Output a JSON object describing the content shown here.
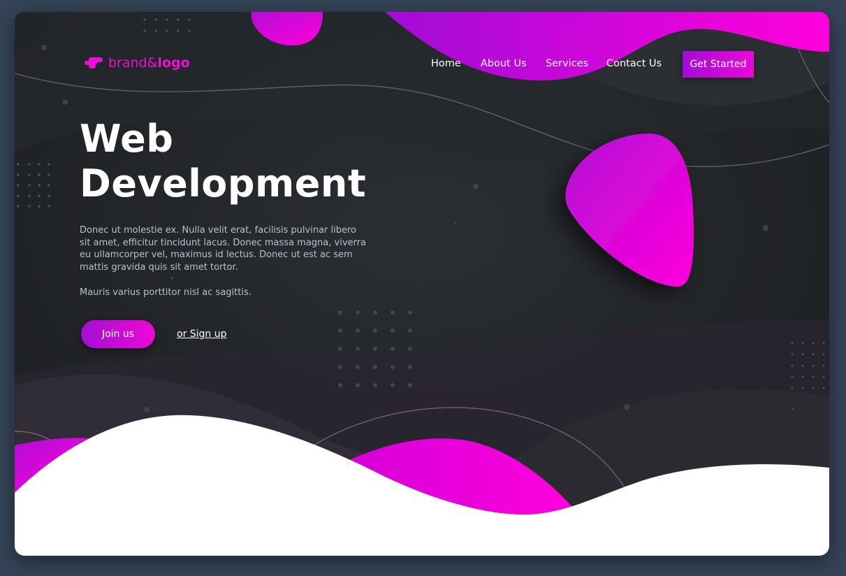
{
  "brand": {
    "name_part1": "brand&",
    "name_part2": "logo",
    "accent_color": "#ee0fd6"
  },
  "nav": {
    "items": [
      {
        "label": "Home"
      },
      {
        "label": "About Us"
      },
      {
        "label": "Services"
      },
      {
        "label": "Contact Us"
      }
    ],
    "cta_label": "Get Started"
  },
  "hero": {
    "title_line1": "Web",
    "title_line2": "Development",
    "paragraph1": "Donec ut molestie ex. Nulla velit erat, facilisis pulvinar libero sit amet, efficitur tincidunt lacus. Donec massa magna, viverra eu ullamcorper vel, maximus id lectus. Donec ut est ac sem mattis gravida quis sit amet tortor.",
    "paragraph2": "Mauris varius porttitor nisl ac sagittis.",
    "primary_button": "Join us",
    "secondary_link": "or Sign up"
  },
  "colors": {
    "background": "#202326",
    "page_backdrop": "#364458",
    "gradient_start": "#a10dd6",
    "gradient_end": "#ff00dc",
    "text_body": "#b8c1cc"
  },
  "icons": {
    "logo_mark": "brand-logo-icon"
  }
}
